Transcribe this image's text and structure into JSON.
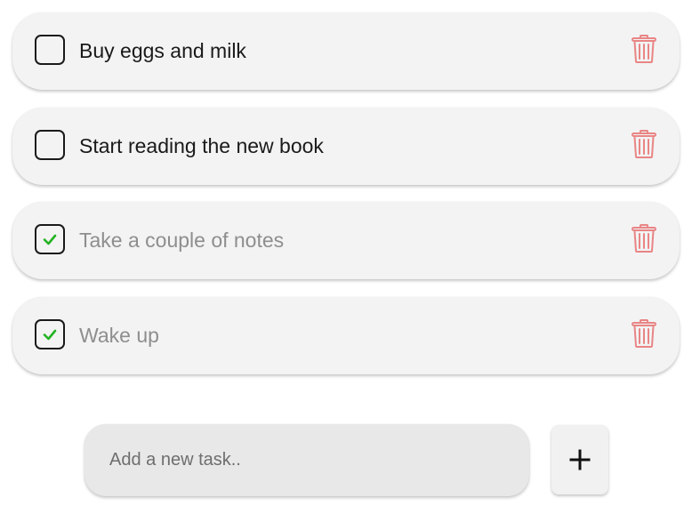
{
  "tasks": [
    {
      "label": "Buy eggs and milk",
      "completed": false
    },
    {
      "label": "Start reading the new book",
      "completed": false
    },
    {
      "label": "Take a couple of notes",
      "completed": true
    },
    {
      "label": "Wake up",
      "completed": true
    }
  ],
  "new_task": {
    "placeholder": "Add a new task..",
    "value": "",
    "add_button_icon": "plus-icon"
  },
  "icons": {
    "checkbox_check": "check-icon",
    "delete": "trash-icon"
  },
  "colors": {
    "check": "#22b322",
    "delete": "#e98585",
    "card_background": "#f3f3f3",
    "input_background": "#e8e8e8",
    "completed_text": "#8e8e8e"
  }
}
